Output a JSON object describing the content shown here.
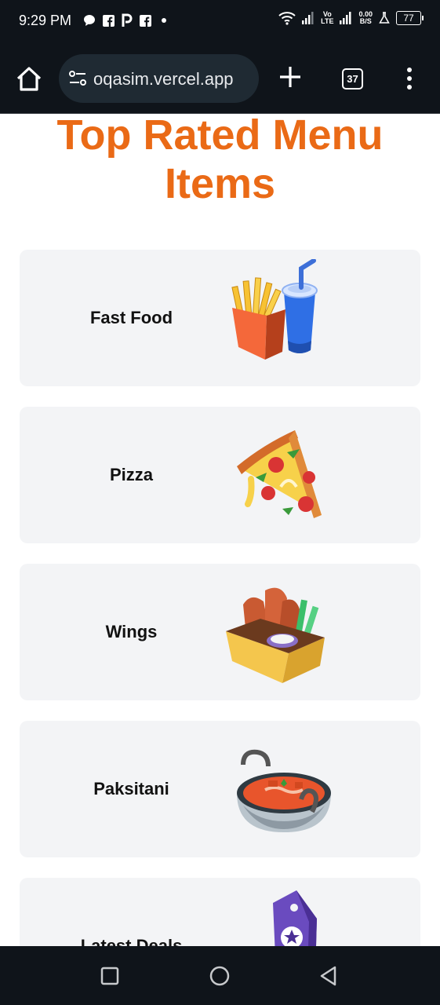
{
  "status_bar": {
    "time": "9:29 PM",
    "volte_top": "Vo",
    "volte_bottom": "LTE",
    "net_speed_value": "0.00",
    "net_speed_unit": "B/S",
    "battery": "77"
  },
  "browser": {
    "url": "oqasim.vercel.app",
    "tab_count": "37"
  },
  "page": {
    "title_line1": "Top Rated Menu",
    "title_line2": "Items",
    "cards": [
      {
        "label": "Fast Food",
        "icon": "fries-and-drink-icon"
      },
      {
        "label": "Pizza",
        "icon": "pizza-slice-icon"
      },
      {
        "label": "Wings",
        "icon": "wings-box-icon"
      },
      {
        "label": "Paksitani",
        "icon": "curry-bowl-icon"
      },
      {
        "label": "Latest Deals",
        "icon": "deal-tag-icon"
      }
    ]
  },
  "colors": {
    "accent": "#ea6a16",
    "card_bg": "#f3f4f6",
    "system_bar": "#0f141a"
  }
}
